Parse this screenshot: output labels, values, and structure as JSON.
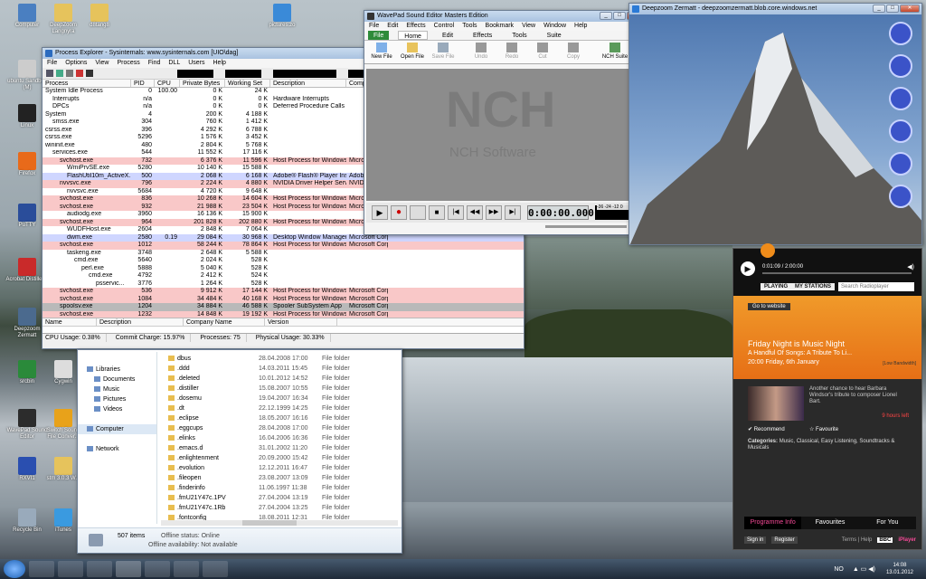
{
  "desktop": {
    "icons": [
      {
        "label": "Computer",
        "color": "#4a7fc1"
      },
      {
        "label": "DeepZoom Langnyra",
        "color": "#e6c35c"
      },
      {
        "label": "d8tang8",
        "color": "#e6c35c"
      },
      {
        "label": "pictures.zo",
        "color": "#3a8ad8"
      },
      {
        "label": "ubuntu Sandbox (M)",
        "color": "#ccc"
      },
      {
        "label": "Linux",
        "color": "#222"
      },
      {
        "label": "Firefox",
        "color": "#e86a1a"
      },
      {
        "label": "PuTTY",
        "color": "#2a4d9a"
      },
      {
        "label": "Acrobat Distiller 9",
        "color": "#c92a2a"
      },
      {
        "label": "Deepzoom Zermatt",
        "color": "#4b6a8e"
      },
      {
        "label": "srcbin",
        "color": "#2a8a3a"
      },
      {
        "label": "Cygwin",
        "color": "#ddd"
      },
      {
        "label": "WavePad Sound Editor",
        "color": "#2c2c2c"
      },
      {
        "label": "Switch Sound File Conver...",
        "color": "#e8a21a"
      },
      {
        "label": "RXVI1",
        "color": "#2a4fb0"
      },
      {
        "label": "stm 3.0.3 W...",
        "color": "#e6c35c"
      },
      {
        "label": "Recycle Bin",
        "color": "#9ab"
      },
      {
        "label": "iTunes",
        "color": "#3a9ae0"
      }
    ]
  },
  "procexp": {
    "title": "Process Explorer - Sysinternals: www.sysinternals.com [UIO\\dag]",
    "menu": [
      "File",
      "Options",
      "View",
      "Process",
      "Find",
      "DLL",
      "Users",
      "Help"
    ],
    "cols": [
      "Process",
      "PID",
      "CPU",
      "Private Bytes",
      "Working Set",
      "Description",
      "Company"
    ],
    "rows": [
      [
        "System Idle Process",
        "0",
        "100.00",
        "0 K",
        "24 K",
        "",
        "",
        0,
        "w"
      ],
      [
        "Interrupts",
        "n/a",
        "",
        "0 K",
        "0 K",
        "Hardware Interrupts",
        "",
        1,
        "w"
      ],
      [
        "DPCs",
        "n/a",
        "",
        "0 K",
        "0 K",
        "Deferred Procedure Calls",
        "",
        1,
        "w"
      ],
      [
        "System",
        "4",
        "",
        "200 K",
        "4 188 K",
        "",
        "",
        0,
        "w"
      ],
      [
        "smss.exe",
        "304",
        "",
        "760 K",
        "1 412 K",
        "",
        "",
        1,
        "w"
      ],
      [
        "csrss.exe",
        "396",
        "",
        "4 292 K",
        "6 788 K",
        "",
        "",
        0,
        "w"
      ],
      [
        "csrss.exe",
        "5296",
        "",
        "1 576 K",
        "3 452 K",
        "",
        "",
        0,
        "w"
      ],
      [
        "wininit.exe",
        "480",
        "",
        "2 804 K",
        "5 768 K",
        "",
        "",
        0,
        "w"
      ],
      [
        "services.exe",
        "544",
        "",
        "11 552 K",
        "17 116 K",
        "",
        "",
        1,
        "w"
      ],
      [
        "svchost.exe",
        "732",
        "",
        "6 376 K",
        "11 596 K",
        "Host Process for Windows S...",
        "Microsoft",
        2,
        "p"
      ],
      [
        "WmiPrvSE.exe",
        "5280",
        "",
        "10 140 K",
        "15 588 K",
        "",
        "",
        3,
        "w"
      ],
      [
        "FlashUtil10m_ActiveX...",
        "500",
        "",
        "2 068 K",
        "6 168 K",
        "Adobe® Flash® Player Install...",
        "Adobe S",
        3,
        "b"
      ],
      [
        "nvvsvc.exe",
        "796",
        "",
        "2 224 K",
        "4 880 K",
        "NVIDIA Driver Helper Servic...",
        "NVIDI",
        2,
        "p"
      ],
      [
        "nvvsvc.exe",
        "5684",
        "",
        "4 720 K",
        "9 648 K",
        "",
        "",
        3,
        "w"
      ],
      [
        "svchost.exe",
        "836",
        "",
        "10 268 K",
        "14 604 K",
        "Host Process for Windows S...",
        "Microsoft",
        2,
        "p"
      ],
      [
        "svchost.exe",
        "932",
        "",
        "21 988 K",
        "23 504 K",
        "Host Process for Windows S...",
        "Microsoft",
        2,
        "p"
      ],
      [
        "audiodg.exe",
        "3960",
        "",
        "16 136 K",
        "15 900 K",
        "",
        "",
        3,
        "w"
      ],
      [
        "svchost.exe",
        "964",
        "",
        "201 828 K",
        "202 880 K",
        "Host Process for Windows S...",
        "Microsoft",
        2,
        "p"
      ],
      [
        "WUDFHost.exe",
        "2604",
        "",
        "2 848 K",
        "7 064 K",
        "",
        "",
        3,
        "w"
      ],
      [
        "dwm.exe",
        "2580",
        "0.19",
        "29 084 K",
        "30 968 K",
        "Desktop Window Manager",
        "Microsoft Corporation",
        3,
        "b"
      ],
      [
        "svchost.exe",
        "1012",
        "",
        "58 244 K",
        "78 864 K",
        "Host Process for Windows S...",
        "Microsoft Corporation",
        2,
        "p"
      ],
      [
        "taskeng.exe",
        "3748",
        "",
        "2 648 K",
        "5 588 K",
        "",
        "",
        3,
        "w"
      ],
      [
        "cmd.exe",
        "5640",
        "",
        "2 024 K",
        "528 K",
        "",
        "",
        4,
        "w"
      ],
      [
        "perl.exe",
        "5888",
        "",
        "5 040 K",
        "528 K",
        "",
        "",
        5,
        "w"
      ],
      [
        "cmd.exe",
        "4792",
        "",
        "2 412 K",
        "524 K",
        "",
        "",
        6,
        "w"
      ],
      [
        "psservic...",
        "3776",
        "",
        "1 264 K",
        "528 K",
        "",
        "",
        7,
        "w"
      ],
      [
        "svchost.exe",
        "536",
        "",
        "9 912 K",
        "17 144 K",
        "Host Process for Windows S...",
        "Microsoft Corporation",
        2,
        "p"
      ],
      [
        "svchost.exe",
        "1084",
        "",
        "34 484 K",
        "40 168 K",
        "Host Process for Windows S...",
        "Microsoft Corporation",
        2,
        "p"
      ],
      [
        "spoolsv.exe",
        "1204",
        "",
        "34 884 K",
        "46 588 K",
        "Spooler SubSystem App",
        "Microsoft Corporation",
        2,
        "g"
      ],
      [
        "svchost.exe",
        "1232",
        "",
        "14 848 K",
        "19 192 K",
        "Host Process for Windows S...",
        "Microsoft Corporation",
        2,
        "p"
      ]
    ],
    "lower_cols": [
      "Name",
      "Description",
      "Company Name",
      "Version"
    ],
    "status": [
      "CPU Usage: 0.38%",
      "Commit Charge: 15.97%",
      "Processes: 75",
      "Physical Usage: 30.33%"
    ]
  },
  "explorer": {
    "nav": [
      {
        "label": "Libraries",
        "indent": 0
      },
      {
        "label": "Documents",
        "indent": 1
      },
      {
        "label": "Music",
        "indent": 1
      },
      {
        "label": "Pictures",
        "indent": 1
      },
      {
        "label": "Videos",
        "indent": 1
      },
      {
        "label": "",
        "indent": 0
      },
      {
        "label": "Computer",
        "indent": 0
      },
      {
        "label": "",
        "indent": 0
      },
      {
        "label": "Network",
        "indent": 0
      }
    ],
    "files": [
      [
        "dbus",
        "28.04.2008 17:00",
        "File folder"
      ],
      [
        ".ddd",
        "14.03.2011 15:45",
        "File folder"
      ],
      [
        ".deleted",
        "10.01.2012 14:52",
        "File folder"
      ],
      [
        ".distiller",
        "15.08.2007 10:55",
        "File folder"
      ],
      [
        ".dosemu",
        "19.04.2007 16:34",
        "File folder"
      ],
      [
        ".dt",
        "22.12.1999 14:25",
        "File folder"
      ],
      [
        ".eclipse",
        "18.05.2007 16:16",
        "File folder"
      ],
      [
        ".eggcups",
        "28.04.2008 17:00",
        "File folder"
      ],
      [
        ".elinks",
        "16.04.2006 16:36",
        "File folder"
      ],
      [
        ".emacs.d",
        "31.01.2002 11:20",
        "File folder"
      ],
      [
        ".enlightenment",
        "20.09.2000 15:42",
        "File folder"
      ],
      [
        ".evolution",
        "12.12.2011 16:47",
        "File folder"
      ],
      [
        ".fileopen",
        "23.08.2007 13:09",
        "File folder"
      ],
      [
        ".finderinfo",
        "11.06.1997 11:38",
        "File folder"
      ],
      [
        ".fmU21Y47c.1PV",
        "27.04.2004 13:19",
        "File folder"
      ],
      [
        ".fmU21Y47c.1Rb",
        "27.04.2004 13:25",
        "File folder"
      ],
      [
        ".fontconfig",
        "18.08.2011 12:31",
        "File folder"
      ]
    ],
    "count": "507 items",
    "offline_status": "Offline status: Online",
    "offline_avail": "Offline availability: Not available"
  },
  "wavepad": {
    "title": "WavePad Sound Editor Masters Edition",
    "menu": [
      "File",
      "Edit",
      "Effects",
      "Control",
      "Tools",
      "Bookmark",
      "View",
      "Window",
      "Help"
    ],
    "tabs": [
      "File",
      "Home",
      "Edit",
      "Effects",
      "Tools",
      "Suite"
    ],
    "tools": [
      "New File",
      "Open File",
      "Save File",
      "Undo",
      "Redo",
      "Cut",
      "Copy",
      "NCH Suite"
    ],
    "logo": "NCH",
    "brand": "NCH Software",
    "time": "0:00:00.000",
    "levels": "-36 -24 -12 0"
  },
  "ie": {
    "title": "Deepzoom Zermatt - deepzoomzermatt.blob.core.windows.net"
  },
  "radio": {
    "time": "0:01:09 / 2:00:00",
    "tabs": [
      "PLAYING",
      "MY STATIONS"
    ],
    "search": "Search Radioplayer",
    "go": "Go to website",
    "headline": "Friday Night is Music Night",
    "sub": "A Handful Of Songs: A Tribute To Li...",
    "when": "20:00 Friday, 6th January",
    "bw": "[Low Bandwidth]",
    "desc": "Another chance to hear Barbara Windsor's tribute to composer Lionel Bart.",
    "ago": "9 hours left",
    "recommend": "Recommend",
    "favourite": "Favourite",
    "cats_label": "Categories:",
    "cats": "Music, Classical, Easy Listening, Soundtracks & Musicals",
    "bottom_tabs": [
      "Programme Info",
      "Favourites",
      "For You"
    ],
    "links": [
      "Sign in",
      "Register"
    ],
    "footer": "Terms | Help",
    "bbc": "BBC",
    "iplayer": "iPlayer"
  },
  "taskbar": {
    "lang": "NO",
    "time": "14:08",
    "date": "13.01.2012"
  }
}
